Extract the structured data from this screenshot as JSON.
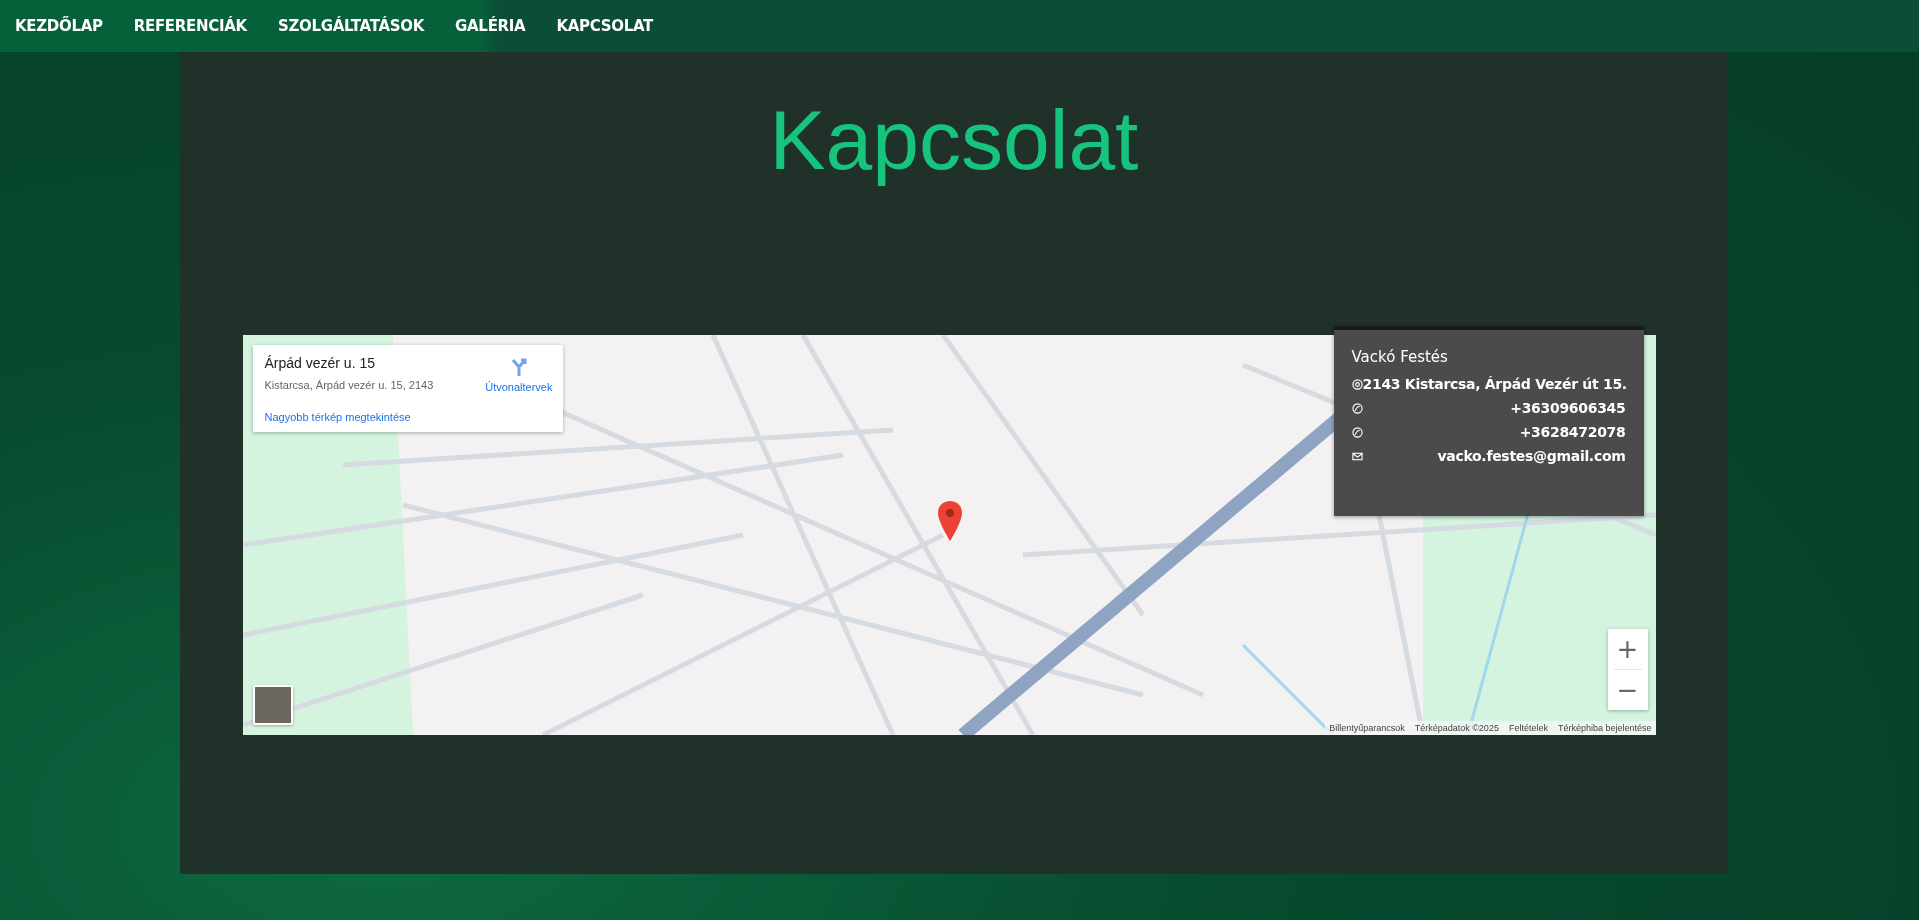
{
  "nav": {
    "items": [
      {
        "label": "KEZDŐLAP"
      },
      {
        "label": "REFERENCIÁK"
      },
      {
        "label": "SZOLGÁLTATÁSOK"
      },
      {
        "label": "GALÉRIA"
      },
      {
        "label": "KAPCSOLAT"
      }
    ]
  },
  "page_title": "Kapcsolat",
  "map": {
    "place_card": {
      "title": "Árpád vezér u. 15",
      "address": "Kistarcsa, Árpád vezér u. 15, 2143",
      "directions": "Útvonaltervek",
      "larger_map_link": "Nagyobb térkép megtekintése"
    },
    "zoom_in": "+",
    "zoom_out": "−",
    "attribution": [
      "Billentyűparancsok",
      "Térképadatok ©2025",
      "Feltételek",
      "Térképhiba bejelentése"
    ]
  },
  "contact": {
    "name": "Vackó Festés",
    "rows": [
      {
        "kind": "address",
        "text": "2143 Kistarcsa, Árpád Vezér út 15."
      },
      {
        "kind": "phone",
        "text": "+36309606345"
      },
      {
        "kind": "phone",
        "text": "+3628472078"
      },
      {
        "kind": "email",
        "text": "vacko.festes@gmail.com"
      }
    ]
  }
}
